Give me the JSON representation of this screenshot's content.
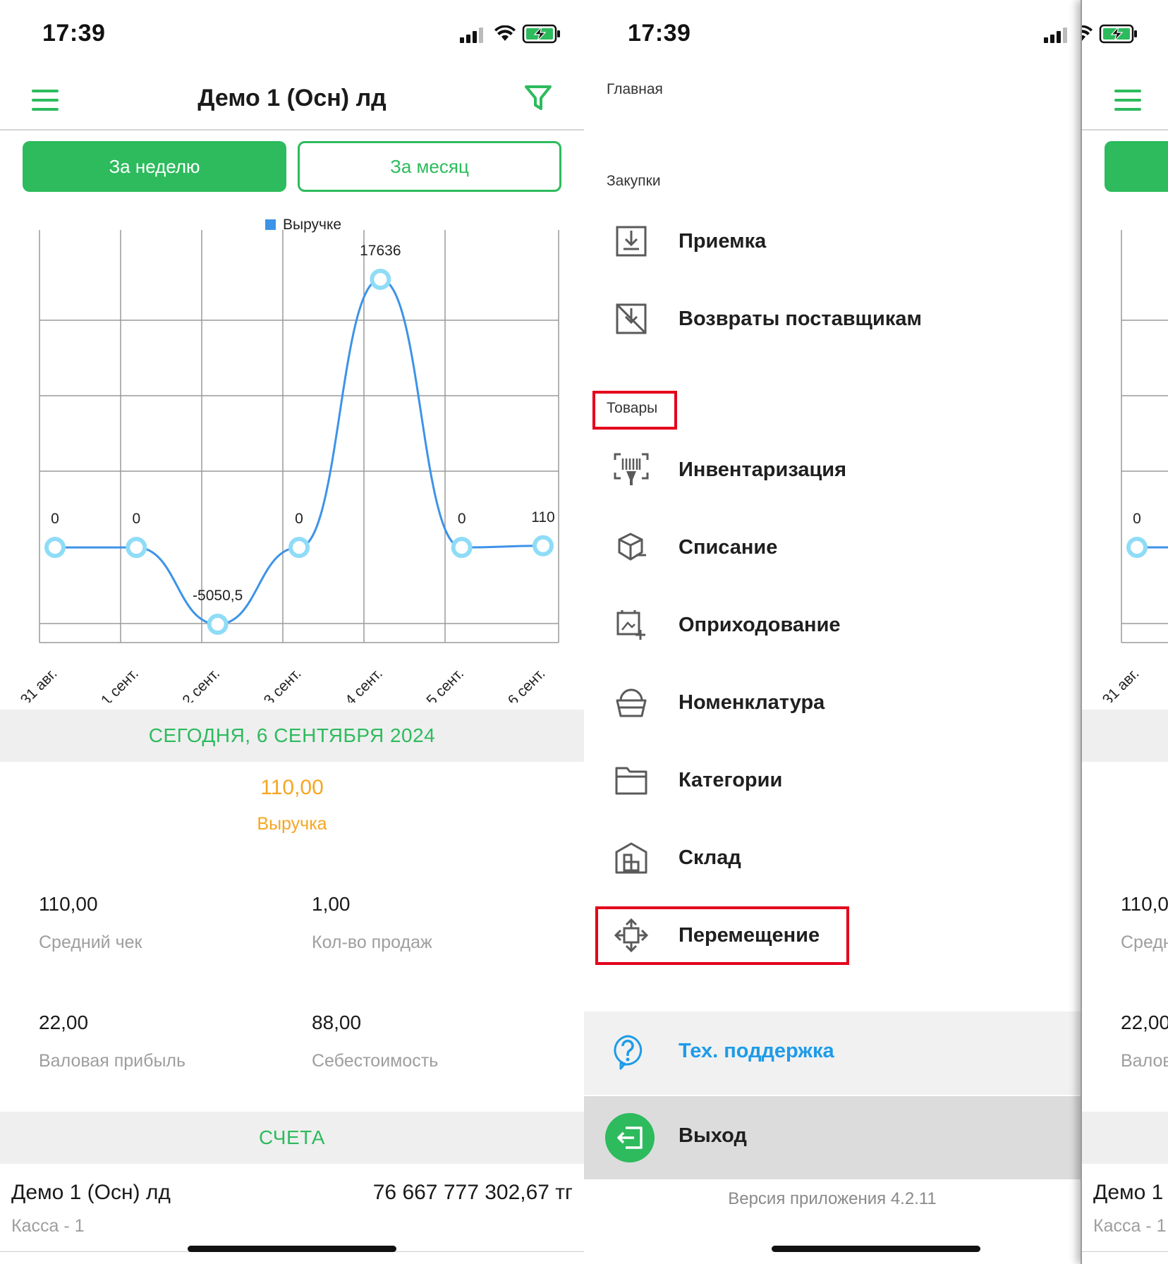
{
  "status_bar": {
    "time": "17:39"
  },
  "header": {
    "title": "Демо 1 (Осн) лд"
  },
  "period_tabs": {
    "week": "За неделю",
    "month": "За месяц"
  },
  "chart_data": {
    "type": "line",
    "legend": "Выручке",
    "categories": [
      "31 авг.",
      "1 сент.",
      "2 сент.",
      "3 сент.",
      "4 сент.",
      "5 сент.",
      "6 сент."
    ],
    "series": [
      {
        "name": "Выручке",
        "values": [
          0,
          0,
          -5050.5,
          0,
          17636,
          0,
          110
        ],
        "labels": [
          "0",
          "0",
          "-5050,5",
          "0",
          "17636",
          "0",
          "110"
        ]
      }
    ],
    "ylim": [
      -5050.5,
      17636
    ],
    "line_color": "#3d93e8",
    "point_color": "#8fdcf7",
    "grid": true
  },
  "today": {
    "heading": "СЕГОДНЯ,  6 СЕНТЯБРЯ 2024",
    "revenue_value": "110,00",
    "revenue_label": "Выручка",
    "stats": [
      {
        "value": "110,00",
        "label": "Средний чек"
      },
      {
        "value": "1,00",
        "label": "Кол-во продаж"
      },
      {
        "value": "22,00",
        "label": "Валовая прибыль"
      },
      {
        "value": "88,00",
        "label": "Себестоимость"
      }
    ]
  },
  "accounts": {
    "heading": "СЧЕТА",
    "name": "Демо 1 (Осн) лд",
    "amount": "76 667 777 302,67 тг",
    "sub": "Касса - 1"
  },
  "menu": {
    "home": "Главная",
    "purchases": "Закупки",
    "goods": "Товары",
    "items": {
      "receiving": "Приемка",
      "returns": "Возвраты поставщикам",
      "inventory": "Инвентаризация",
      "writeoff": "Списание",
      "posting": "Оприходование",
      "nomenclature": "Номенклатура",
      "categories": "Категории",
      "warehouse": "Склад",
      "transfer": "Перемещение"
    },
    "support": "Тех. поддержка",
    "logout": "Выход",
    "version": "Версия приложения 4.2.11"
  },
  "right_peek": {
    "zero_label": "0",
    "xtick": "31 авг.",
    "stat1": "110,0",
    "stat1_lbl": "Средн",
    "stat2": "22,00",
    "stat2_lbl": "Валов",
    "account": "Демо 1",
    "account_sub": "Касса - 1"
  },
  "colors": {
    "accent": "#2dbb5d",
    "revenue": "#f5a623",
    "support": "#1e9be8",
    "highlight": "#e3001b"
  }
}
